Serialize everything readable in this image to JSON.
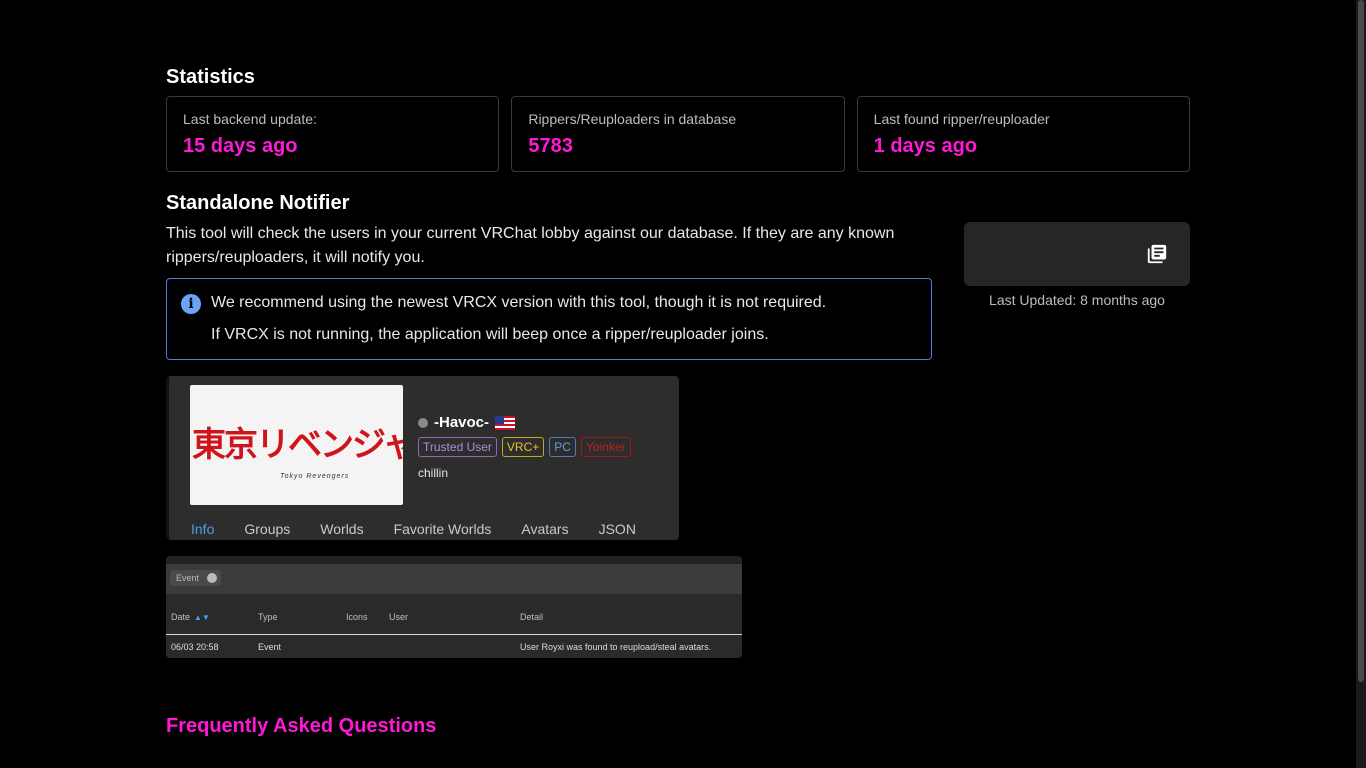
{
  "statistics": {
    "title": "Statistics",
    "cards": [
      {
        "label": "Last backend update:",
        "value": "15 days ago"
      },
      {
        "label": "Rippers/Reuploaders in database",
        "value": "5783"
      },
      {
        "label": "Last found ripper/reuploader",
        "value": "1 days ago"
      }
    ]
  },
  "notifier": {
    "title": "Standalone Notifier",
    "description": "This tool will check the users in your current VRChat lobby against our database. If they are any known rippers/reuploaders, it will notify you.",
    "alert": {
      "line1": "We recommend using the newest VRCX version with this tool, though it is not required.",
      "line2": "If VRCX is not running, the application will beep once a ripper/reuploader joins."
    },
    "download": {
      "icon": "library-books-icon"
    },
    "last_updated": "Last Updated: 8 months ago"
  },
  "profile_screenshot": {
    "avatar_jp": "東京リベンジャーズ",
    "avatar_en": "Tokyo Revengers",
    "name": "-Havoc-",
    "tags": [
      "Trusted User",
      "VRC+",
      "PC",
      "Yoinker"
    ],
    "status": "chillin",
    "tabs": [
      "Info",
      "Groups",
      "Worlds",
      "Favorite Worlds",
      "Avatars",
      "JSON"
    ]
  },
  "feed_screenshot": {
    "filter_chip": "Event",
    "columns": [
      "Date",
      "Type",
      "Icons",
      "User",
      "Detail"
    ],
    "rows": [
      {
        "date": "06/03 20:58",
        "type": "Event",
        "icons": "",
        "user": "",
        "detail": "User Royxi was found to reupload/steal avatars."
      }
    ]
  },
  "faq": {
    "title": "Frequently Asked Questions"
  },
  "colors": {
    "accent": "#ff19d7",
    "info": "#6aa5f5"
  }
}
